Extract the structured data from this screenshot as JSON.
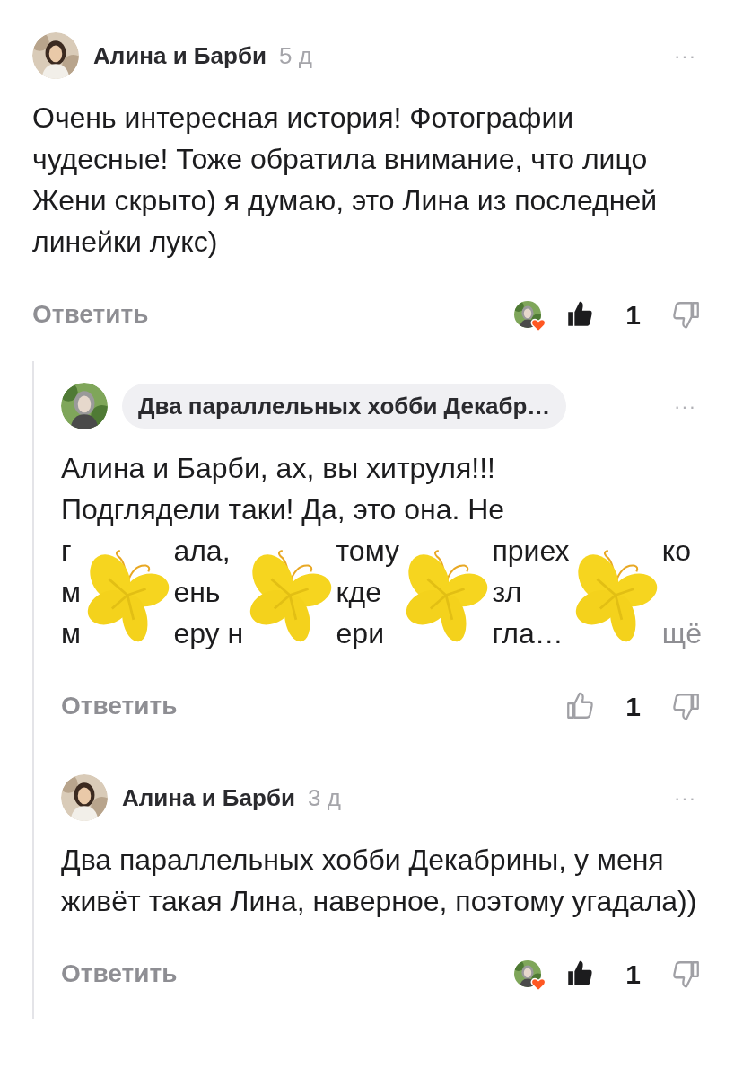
{
  "comments": [
    {
      "author": "Алина и Барби",
      "kind": "plain",
      "time": "5 д",
      "more": "···",
      "text": "Очень интересная история! Фотографии чудесные! Тоже обратила внимание, что лицо Жени скрыто) я думаю, это Лина из последней линейки лукс)",
      "reply_label": "Ответить",
      "reactor_avatar": true,
      "liked": true,
      "count": "1",
      "replies": [
        {
          "author": "Два параллельных хобби Декабр…",
          "kind": "chip",
          "more": "···",
          "text_lines": [
            "Алина и Барби, ах, вы хитруля!!!",
            "Подглядели таки! Да, это она. Не"
          ],
          "covered_lines": [
            [
              "г",
              "ала,",
              "тому",
              "приех",
              "ко"
            ],
            [
              "м",
              "ень",
              "кде",
              "зл"
            ],
            [
              "м",
              "еру н",
              "ери",
              "гла…"
            ]
          ],
          "more_link": "щё",
          "reply_label": "Ответить",
          "reactor_avatar": false,
          "liked": false,
          "count": "1"
        },
        {
          "author": "Алина и Барби",
          "kind": "plain",
          "time": "3 д",
          "more": "···",
          "text": "Два параллельных хобби Декабрины, у меня живёт такая Лина, наверное, поэтому угадала))",
          "reply_label": "Ответить",
          "reactor_avatar": true,
          "liked": true,
          "count": "1"
        }
      ]
    }
  ]
}
